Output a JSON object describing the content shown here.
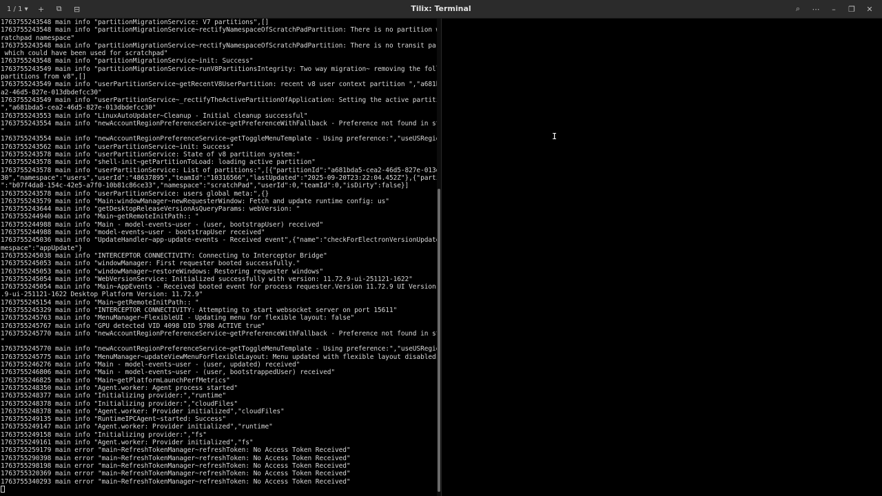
{
  "window": {
    "title": "Tilix: Terminal",
    "session_selector": "1 / 1 ▾"
  },
  "icons": {
    "add": "+",
    "split_right": "⧉",
    "split_down": "⊟",
    "search": "⌕",
    "menu": "⋯",
    "minimize": "–",
    "maximize": "❐",
    "close": "✕",
    "mouse": "I"
  },
  "terminal": {
    "lines": [
      "1763755243548 main info \"partitionMigrationService: V7 partitions\",[]",
      "1763755243548 main info \"partitionMigrationService~rectifyNamespaceOfScratchPadPartition: There is no partition with sc",
      "ratchpad namespace\"",
      "1763755243548 main info \"partitionMigrationService~rectifyNamespaceOfScratchPadPartition: There is no transit partition",
      " which could have been used for scratchpad\"",
      "1763755243548 main info \"partitionMigrationService~init: Success\"",
      "1763755243549 main info \"partitionMigrationService~runV8PartitionsIntegrity: Two way migration~ removing the following",
      "partitions from v8\",[]",
      "1763755243549 main info \"userPartitionService~getRecentV8UserPartition: recent v8 user context partition \",\"a681bda5-ce",
      "a2-46d5-827e-013dbdefcc30\"",
      "1763755243549 main info \"userPartitionService~_rectifyTheActivePartitionOfApplication: Setting the active partition to",
      "\",\"a681bda5-cea2-46d5-827e-013dbdefcc30\"",
      "1763755243553 main info \"LinuxAutoUpdater~Cleanup - Initial cleanup successful\"",
      "1763755243554 main info \"newAccountRegionPreferenceService~getPreferenceWithFallback - Preference not found in storage.",
      "\"",
      "1763755243554 main info \"newAccountRegionPreferenceService~getToggleMenuTemplate - Using preference:\",\"useUSRegion\"",
      "1763755243562 main info \"userPartitionService~init: Success\"",
      "1763755243578 main info \"userPartitionService: State of v8 partition system:\"",
      "1763755243578 main info \"shell-init~getPartitionToLoad: loading active partition\"",
      "1763755243578 main info \"userPartitionService: List of partitions:\",[{\"partitionId\":\"a681bda5-cea2-46d5-827e-013dbdefcc",
      "30\",\"namespace\":\"users\",\"userId\":\"48637895\",\"teamId\":\"10316566\",\"lastUpdated\":\"2025-09-20T23:22:04.452Z\"},{\"partitionId",
      "\":\"b07f4da8-154c-42e5-a7f0-10b81c86ce33\",\"namespace\":\"scratchPad\",\"userId\":0,\"teamId\":0,\"isDirty\":false}]",
      "1763755243578 main info \"userPartitionService: users global meta:\",{}",
      "1763755243579 main info \"Main:windowManager~newRequesterWindow: Fetch and update runtime config: us\"",
      "1763755243644 main info \"getDesktopReleaseVersionAsQueryParams: webVersion: \"",
      "1763755244940 main info \"Main~getRemoteInitPath:: \"",
      "1763755244988 main info \"Main - model-events~user - (user, bootstrapUser) received\"",
      "1763755244988 main info \"model-events~user - bootstrapUser received\"",
      "1763755245036 main info \"UpdateHandler~app-update-events - Received event\",{\"name\":\"checkForElectronVersionUpdated\",\"na",
      "mespace\":\"appUpdate\"}",
      "1763755245038 main info \"INTERCEPTOR CONNECTIVITY: Connecting to Interceptor Bridge\"",
      "1763755245053 main info \"windowManager: First requester booted successfully.\"",
      "1763755245053 main info \"windowManager~restoreWindows: Restoring requester windows\"",
      "1763755245054 main info \"WebVersionService: Initialized successfully with version: 11.72.9-ui-251121-1622\"",
      "1763755245054 main info \"Main~AppEvents - Received booted event for process requester.Version 11.72.9 UI Version: 11.72",
      ".9-ui-251121-1622 Desktop Platform Version: 11.72.9\"",
      "1763755245154 main info \"Main~getRemoteInitPath:: \"",
      "1763755245329 main info \"INTERCEPTOR CONNECTIVITY: Attempting to start websocket server on port 15611\"",
      "1763755245763 main info \"MenuManager~FlexibleUI - Updating menu for flexible layout: false\"",
      "1763755245767 main info \"GPU detected VID 4098 DID 5708 ACTIVE true\"",
      "1763755245770 main info \"newAccountRegionPreferenceService~getPreferenceWithFallback - Preference not found in storage.",
      "\"",
      "1763755245770 main info \"newAccountRegionPreferenceService~getToggleMenuTemplate - Using preference:\",\"useUSRegion\"",
      "1763755245775 main info \"MenuManager~updateViewMenuForFlexibleLayout: Menu updated with flexible layout disabled\"",
      "1763755246276 main info \"Main - model-events~user - (user, updated) received\"",
      "1763755246806 main info \"Main - model-events~user - (user, bootstrappedUser) received\"",
      "1763755246825 main info \"Main~getPlatformLaunchPerfMetrics\"",
      "1763755248350 main info \"Agent.worker: Agent process started\"",
      "1763755248377 main info \"Initializing provider:\",\"runtime\"",
      "1763755248378 main info \"Initializing provider:\",\"cloudFiles\"",
      "1763755248378 main info \"Agent.worker: Provider initialized\",\"cloudFiles\"",
      "1763755249135 main info \"RuntimeIPCAgent~started: Success\"",
      "1763755249147 main info \"Agent.worker: Provider initialized\",\"runtime\"",
      "1763755249158 main info \"Initializing provider:\",\"fs\"",
      "1763755249161 main info \"Agent.worker: Provider initialized\",\"fs\"",
      "1763755259179 main error \"main~RefreshTokenManager~refreshToken: No Access Token Received\"",
      "1763755290398 main error \"main~RefreshTokenManager~refreshToken: No Access Token Received\"",
      "1763755298198 main error \"main~RefreshTokenManager~refreshToken: No Access Token Received\"",
      "1763755320369 main error \"main~RefreshTokenManager~refreshToken: No Access Token Received\"",
      "1763755340293 main error \"main~RefreshTokenManager~refreshToken: No Access Token Received\""
    ]
  }
}
